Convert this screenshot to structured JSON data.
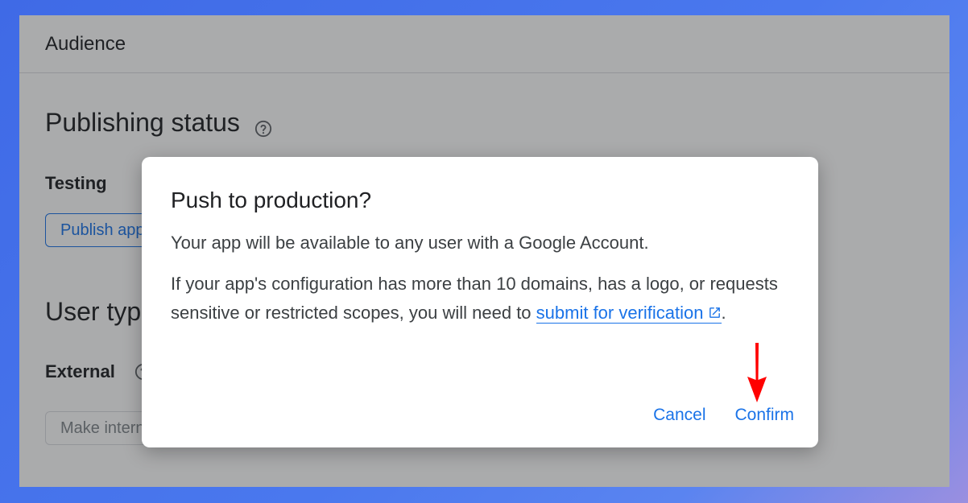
{
  "header": {
    "title": "Audience"
  },
  "publishing": {
    "title": "Publishing status",
    "status_label": "Testing",
    "publish_button": "Publish app"
  },
  "user_type": {
    "title": "User type",
    "value_label": "External",
    "make_internal_button": "Make internal"
  },
  "dialog": {
    "title": "Push to production?",
    "p1": "Your app will be available to any user with a Google Account.",
    "p2_pre": "If your app's configuration has more than 10 domains, has a logo, or requests sensitive or restricted scopes, you will need to ",
    "p2_link": "submit for verification",
    "p2_post": ".",
    "cancel_label": "Cancel",
    "confirm_label": "Confirm"
  },
  "colors": {
    "accent": "#1a73e8",
    "annotation_arrow": "#ff0000"
  },
  "icons": {
    "help": "help-circle-icon",
    "external_link": "open-in-new-icon",
    "annotation": "red-arrow-down-icon"
  }
}
